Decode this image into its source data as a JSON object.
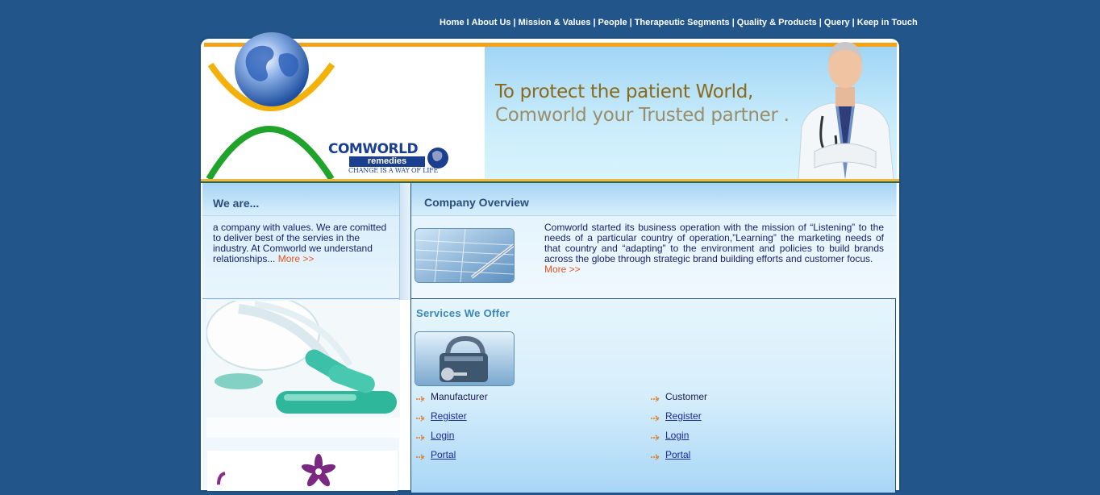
{
  "nav": {
    "items": [
      "Home",
      "About Us",
      "Mission & Values",
      "People",
      "Therapeutic Segments",
      "Quality & Products",
      "Query",
      "Keep in Touch"
    ],
    "first_sep": "I",
    "sep": "|"
  },
  "header": {
    "tagline_line1": "To protect the patient World,",
    "tagline_line2": "Comworld your Trusted partner .",
    "logo_name": "COMWORLD",
    "logo_sub": "remedies",
    "logo_tag": "CHANGE IS A WAY OF LIFE"
  },
  "we_are": {
    "title": "We are...",
    "text": "a company with values. We are comitted to deliver best of the servies in the industry. At Comworld we understand relationships... ",
    "more": "More >>"
  },
  "overview": {
    "title": "Company Overview",
    "text": "Comworld started its business operation with the mission of “Listening” to the needs of a particular country of operation,”Learning” the marketing needs of that country and “adapting” to the environment and policies to build brands across the globe through strategic brand building efforts and customer focus.",
    "more": "More >>"
  },
  "services": {
    "title": "Services We Offer",
    "manufacturer": {
      "label": "Manufacturer",
      "register": "Register",
      "login": "Login",
      "portal": "Portal"
    },
    "customer": {
      "label": "Customer",
      "register": "Register",
      "login": "Login",
      "portal": "Portal"
    }
  },
  "colors": {
    "background": "#22568a",
    "accent_orange": "#f4a21a",
    "link_more": "#e8531c",
    "title_blue": "#2a4f7a"
  }
}
